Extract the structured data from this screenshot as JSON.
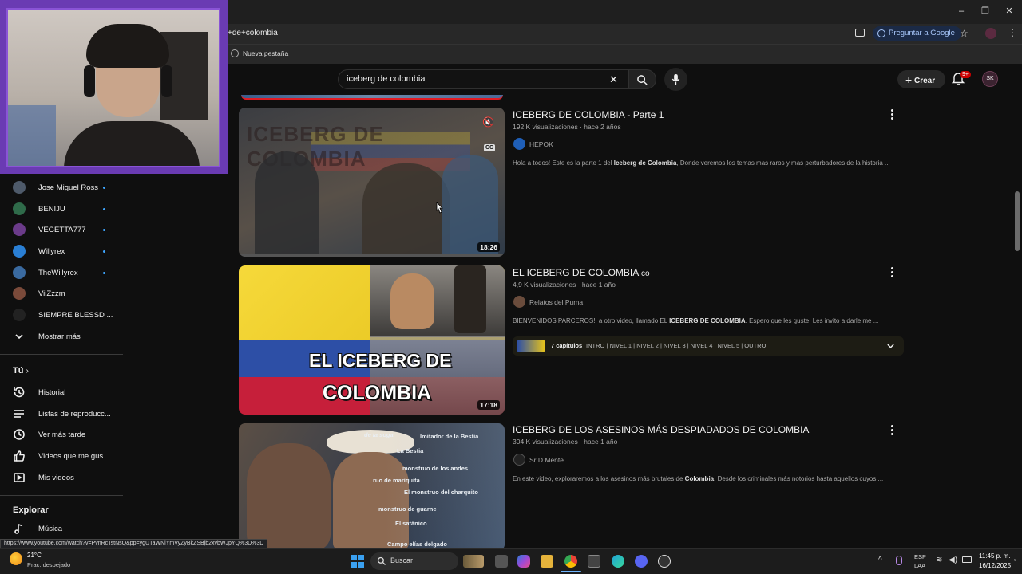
{
  "browser": {
    "address_text": "+de+colombia",
    "bookmark_label": "Nueva pestaña",
    "ask_google_label": "Preguntar a Google",
    "status_url": "https://www.youtube.com/watch?v=PvnRcTstNsQ&pp=ygUTaWNlYmVyZyBkZSBjb2xvbWJpYQ%3D%3D"
  },
  "masthead": {
    "search_value": "iceberg de colombia",
    "create_label": "Crear",
    "notifications_badge": "9+",
    "avatar_initials": "SK"
  },
  "sidebar": {
    "subscriptions": [
      {
        "label": "Jose Miguel Ross",
        "color": "#4e5a6a"
      },
      {
        "label": "BENIJU",
        "color": "#2f6b4a"
      },
      {
        "label": "VEGETTA777",
        "color": "#6b3b8a"
      },
      {
        "label": "Willyrex",
        "color": "#2a7fd4"
      },
      {
        "label": "TheWillyrex",
        "color": "#3a6aa0"
      },
      {
        "label": "ViiZzzm",
        "color": "#7a4a3a"
      },
      {
        "label": "SIEMPRE BLESSD ...",
        "color": "#222222"
      }
    ],
    "show_more": "Mostrar más",
    "you_section": "Tú",
    "you_items": [
      {
        "label": "Historial",
        "icon": "history-icon"
      },
      {
        "label": "Listas de reproducc...",
        "icon": "playlists-icon"
      },
      {
        "label": "Ver más tarde",
        "icon": "clock-icon"
      },
      {
        "label": "Videos que me gus...",
        "icon": "thumbs-up-icon"
      },
      {
        "label": "Mis videos",
        "icon": "my-videos-icon"
      }
    ],
    "explore_section": "Explorar",
    "explore_items": [
      {
        "label": "Música",
        "icon": "music-icon"
      }
    ]
  },
  "results": [
    {
      "title": "ICEBERG DE COLOMBIA - Parte 1",
      "meta": "192 K visualizaciones · hace 2 años",
      "channel": "HEPOK",
      "desc_pre": "Hola a todos! Este es la parte 1 del ",
      "desc_bold": "Iceberg de Colombia",
      "desc_post": ", Donde veremos los temas mas raros y mas perturbadores de la historia ...",
      "duration": "18:26",
      "cc": "CC"
    },
    {
      "title": "EL ICEBERG DE COLOMBIA",
      "flag": "co",
      "meta": "4,9 K visualizaciones · hace 1 año",
      "channel": "Relatos del Puma",
      "desc_pre": "BIENVENIDOS PARCEROS!, a otro video, llamado EL ",
      "desc_bold": "ICEBERG DE COLOMBIA",
      "desc_post": ". Espero que les guste. Les invito a darle me ...",
      "duration": "17:18",
      "thumb_text_1": "EL ICEBERG DE",
      "thumb_text_2": "COLOMBIA",
      "chapters_count": "7 capítulos",
      "chapters_list": "INTRO | NIVEL 1 | NIVEL 2 | NIVEL 3 | NIVEL 4 | NIVEL 5 | OUTRO"
    },
    {
      "title": "ICEBERG DE LOS ASESINOS MÁS DESPIADADOS DE COLOMBIA",
      "meta": "304 K visualizaciones · hace 1 año",
      "channel": "Sr D Mente",
      "desc_pre": "En este video, exploraremos a los asesinos más brutales de ",
      "desc_bold": "Colombia",
      "desc_post": ". Desde los criminales más notorios hasta aquellos cuyos ...",
      "thumb_labels": [
        "de la soga",
        "Imitador de la Bestia",
        "La Bestia",
        "monstruo de los andes",
        "ruo de mariquita",
        "El monstruo del charquito",
        "monstruo de guarne",
        "El satánico",
        "Campo elías delgado"
      ]
    }
  ],
  "taskbar": {
    "weather_temp": "21°C",
    "weather_desc": "Prac. despejado",
    "search_label": "Buscar",
    "lang_1": "ESP",
    "lang_2": "LAA",
    "time": "11:45 p. m.",
    "date": "16/12/2025"
  }
}
